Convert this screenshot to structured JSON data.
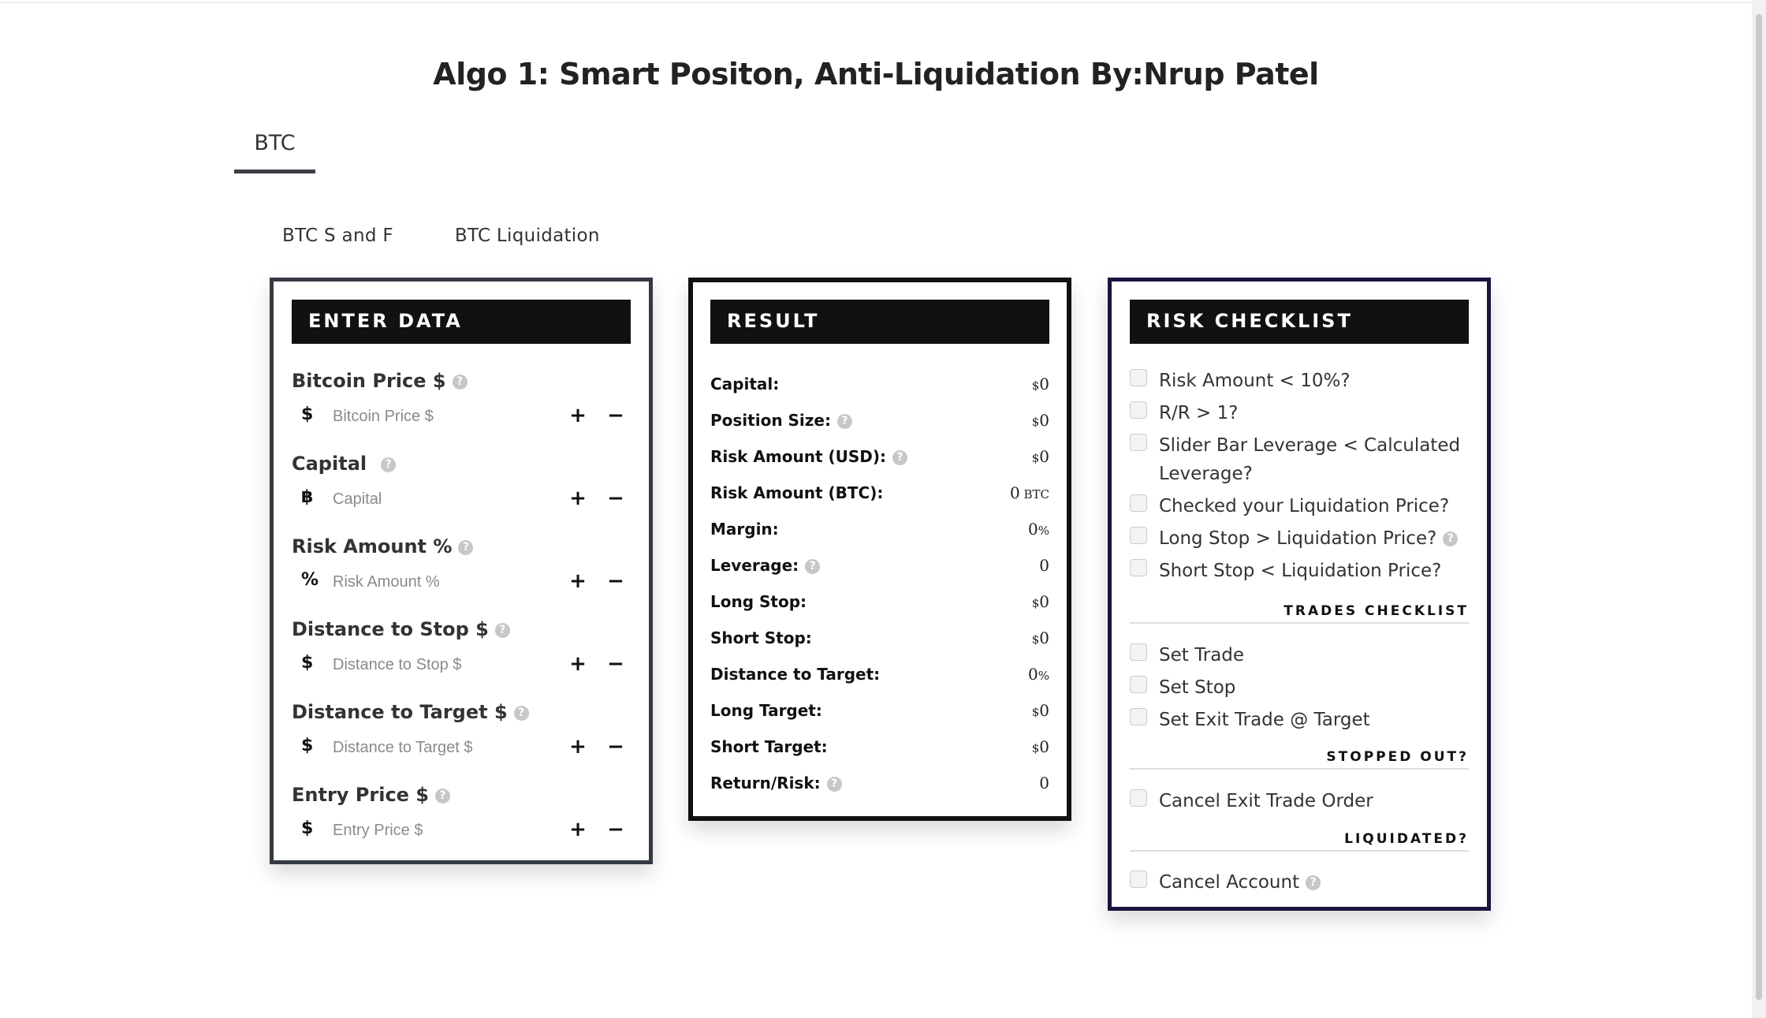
{
  "page": {
    "title": "Algo 1: Smart Positon, Anti-Liquidation By:Nrup Patel",
    "main_tab": "BTC",
    "subtabs": [
      "BTC S and F",
      "BTC Liquidation"
    ]
  },
  "enter_data": {
    "heading": "ENTER DATA",
    "fields": [
      {
        "label": "Bitcoin Price $",
        "prefix": "$",
        "placeholder": "Bitcoin Price $",
        "icon": "dollar-icon"
      },
      {
        "label": "Capital",
        "prefix": "฿",
        "placeholder": "Capital",
        "icon": "bitcoin-icon"
      },
      {
        "label": "Risk Amount %",
        "prefix": "%",
        "placeholder": "Risk Amount %",
        "icon": "percent-icon"
      },
      {
        "label": "Distance to Stop $",
        "prefix": "$",
        "placeholder": "Distance to Stop $",
        "icon": "dollar-icon"
      },
      {
        "label": "Distance to Target $",
        "prefix": "$",
        "placeholder": "Distance to Target $",
        "icon": "dollar-icon"
      },
      {
        "label": "Entry Price $",
        "prefix": "$",
        "placeholder": "Entry Price $",
        "icon": "dollar-icon"
      }
    ],
    "plus_label": "+",
    "minus_label": "−"
  },
  "result": {
    "heading": "RESULT",
    "rows": [
      {
        "label": "Capital:",
        "prefix": "$",
        "value": "0",
        "suffix": "",
        "help": false
      },
      {
        "label": "Position Size:",
        "prefix": "$",
        "value": "0",
        "suffix": "",
        "help": true
      },
      {
        "label": "Risk Amount (USD):",
        "prefix": "$",
        "value": "0",
        "suffix": "",
        "help": true
      },
      {
        "label": "Risk Amount (BTC):",
        "prefix": "",
        "value": "0",
        "suffix": " BTC",
        "help": false
      },
      {
        "label": "Margin:",
        "prefix": "",
        "value": "0",
        "suffix": "%",
        "help": false
      },
      {
        "label": "Leverage:",
        "prefix": "",
        "value": "0",
        "suffix": "",
        "help": true
      },
      {
        "label": "Long Stop:",
        "prefix": "$",
        "value": "0",
        "suffix": "",
        "help": false
      },
      {
        "label": "Short Stop:",
        "prefix": "$",
        "value": "0",
        "suffix": "",
        "help": false
      },
      {
        "label": "Distance to Target:",
        "prefix": "",
        "value": "0",
        "suffix": "%",
        "help": false
      },
      {
        "label": "Long Target:",
        "prefix": "$",
        "value": "0",
        "suffix": "",
        "help": false
      },
      {
        "label": "Short Target:",
        "prefix": "$",
        "value": "0",
        "suffix": "",
        "help": false
      },
      {
        "label": "Return/Risk:",
        "prefix": "",
        "value": "0",
        "suffix": "",
        "help": true
      }
    ]
  },
  "risk_checklist": {
    "heading": "RISK CHECKLIST",
    "items": [
      {
        "text": "Risk Amount < 10%?",
        "help": false
      },
      {
        "text": "R/R > 1?",
        "help": false
      },
      {
        "text": "Slider Bar Leverage < Calculated Leverage?",
        "help": false
      },
      {
        "text": "Checked your Liquidation Price?",
        "help": false
      },
      {
        "text": "Long Stop > Liquidation Price?",
        "help": true
      },
      {
        "text": "Short Stop < Liquidation Price?",
        "help": false
      }
    ],
    "trades_heading": "TRADES CHECKLIST",
    "trades_items": [
      "Set Trade",
      "Set Stop",
      "Set Exit Trade @ Target"
    ],
    "stopped_heading": "STOPPED OUT?",
    "stopped_items": [
      "Cancel Exit Trade Order"
    ],
    "liquidated_heading": "LIQUIDATED?",
    "liquidated_items": [
      "Cancel Account"
    ]
  },
  "help_glyph": "?"
}
